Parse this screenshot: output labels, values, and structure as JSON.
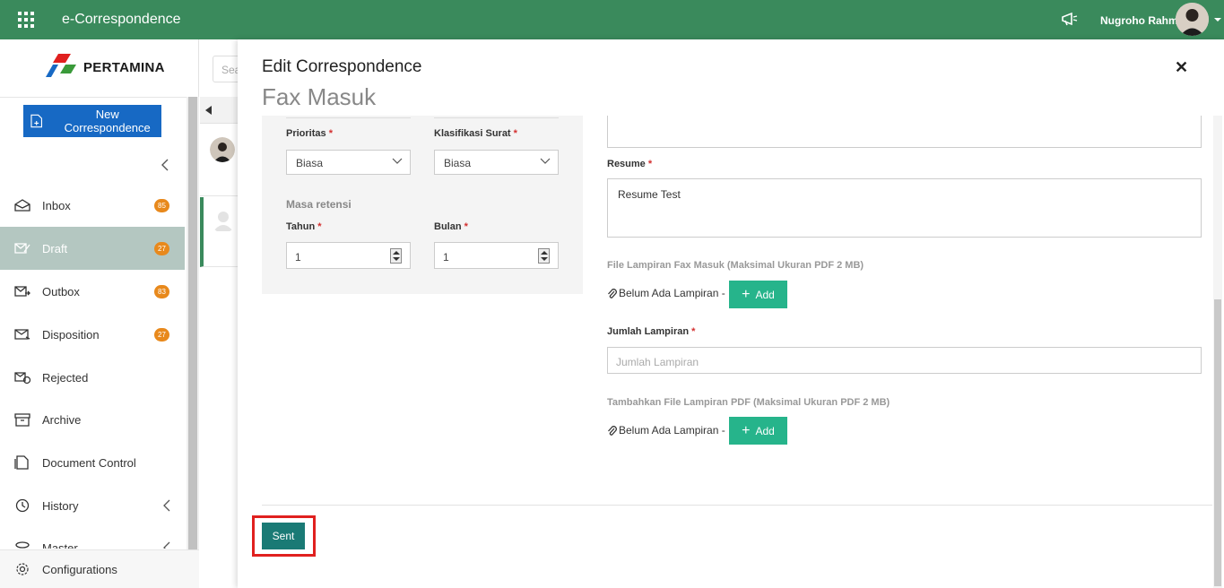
{
  "app": {
    "title": "e-Correspondence",
    "user_name": "Nugroho Rahm"
  },
  "sidebar": {
    "logo_text": "PERTAMINA",
    "new_button": "New Correspondence",
    "items": [
      {
        "label": "Inbox",
        "badge": "85",
        "icon": "inbox-icon"
      },
      {
        "label": "Draft",
        "badge": "27",
        "icon": "draft-icon",
        "active": true
      },
      {
        "label": "Outbox",
        "badge": "83",
        "icon": "outbox-icon"
      },
      {
        "label": "Disposition",
        "badge": "27",
        "icon": "disposition-icon"
      },
      {
        "label": "Rejected",
        "badge": "",
        "icon": "rejected-icon"
      },
      {
        "label": "Archive",
        "badge": "",
        "icon": "archive-icon"
      },
      {
        "label": "Document Control",
        "badge": "",
        "icon": "document-control-icon"
      },
      {
        "label": "History",
        "badge": "",
        "icon": "history-icon"
      },
      {
        "label": "Master",
        "badge": "",
        "icon": "master-icon"
      }
    ],
    "configurations": "Configurations"
  },
  "list": {
    "search_placeholder": "Sea"
  },
  "modal": {
    "title": "Edit Correspondence",
    "subtitle": "Fax Masuk",
    "left": {
      "prioritas_label": "Prioritas",
      "prioritas_value": "Biasa",
      "klasifikasi_label": "Klasifikasi Surat",
      "klasifikasi_value": "Biasa",
      "masa_retensi": "Masa retensi",
      "tahun_label": "Tahun",
      "tahun_value": "1",
      "bulan_label": "Bulan",
      "bulan_value": "1"
    },
    "right": {
      "resume_label": "Resume",
      "resume_value": "Resume Test",
      "file_fax_label": "File Lampiran Fax Masuk (Maksimal Ukuran PDF 2 MB)",
      "no_attachment": "Belum Ada Lampiran -",
      "add_label": "Add",
      "jumlah_label": "Jumlah Lampiran",
      "jumlah_placeholder": "Jumlah Lampiran",
      "tambah_label": "Tambahkan File Lampiran PDF (Maksimal Ukuran PDF 2 MB)"
    },
    "required_mark": "*",
    "sent_label": "Sent"
  },
  "colors": {
    "topbar": "#3a8a5c",
    "primary": "#1769c4",
    "add": "#26b48b",
    "sent": "#1a7a75",
    "badge": "#e8891c",
    "highlight": "#e0201f"
  }
}
